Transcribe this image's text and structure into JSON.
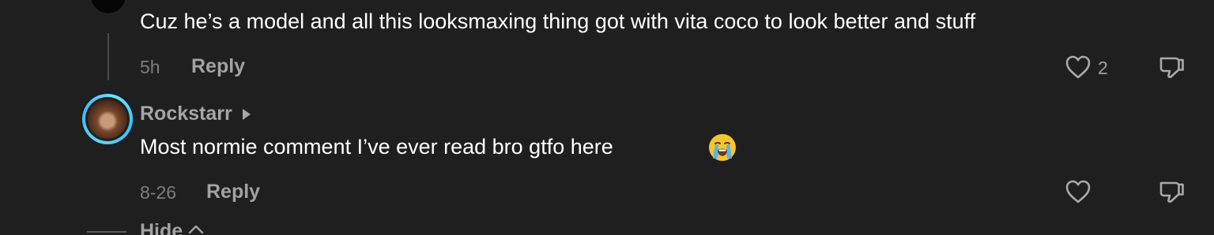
{
  "comments": [
    {
      "text": "Cuz he’s a model and all this looksmaxing thing got with vita coco to look better and stuff",
      "time": "5h",
      "reply_label": "Reply",
      "likes": "2"
    },
    {
      "username": "Rockstarr",
      "text": "Most normie comment I’ve ever read bro gtfo here",
      "emoji": "😭",
      "time": "8-26",
      "reply_label": "Reply",
      "likes": ""
    }
  ],
  "hide_label": "Hide",
  "colors": {
    "background": "#1f1f1f",
    "text_primary": "#ffffff",
    "text_secondary": "#a2a2a2",
    "avatar_ring": "#43b8ff"
  },
  "icons": {
    "like": "heart-outline-icon",
    "dislike": "thumbs-down-outline-icon",
    "caret": "caret-right-icon",
    "hide": "chevron-up-icon"
  }
}
